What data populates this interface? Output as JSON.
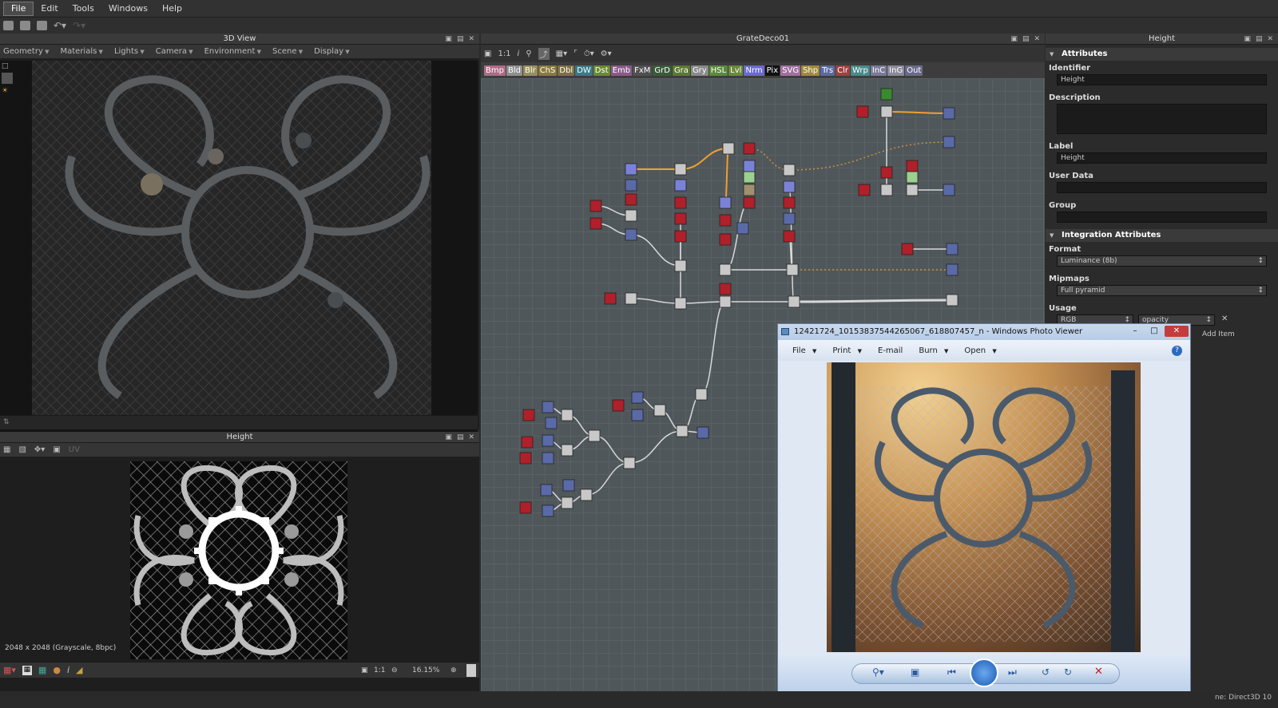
{
  "menubar": {
    "items": [
      "File",
      "Edit",
      "Tools",
      "Windows",
      "Help"
    ]
  },
  "view3d": {
    "title": "3D View",
    "menus": [
      "Geometry",
      "Materials",
      "Lights",
      "Camera",
      "Environment",
      "Scene",
      "Display"
    ]
  },
  "height": {
    "title": "Height",
    "info": "2048 x 2048 (Grayscale, 8bpc)",
    "zoom": "16.15%",
    "ratio": "1:1",
    "uv_label": "UV"
  },
  "graph": {
    "title": "GrateDeco01",
    "ratio": "1:1",
    "node_buttons": [
      {
        "label": "Bmp",
        "color": "#b06a86"
      },
      {
        "label": "Bld",
        "color": "#8f8f8f"
      },
      {
        "label": "Blr",
        "color": "#9a8f5a"
      },
      {
        "label": "ChS",
        "color": "#8a7a3a"
      },
      {
        "label": "Dbl",
        "color": "#807040"
      },
      {
        "label": "DW",
        "color": "#3a7a86"
      },
      {
        "label": "Dst",
        "color": "#6a8a30"
      },
      {
        "label": "Emb",
        "color": "#8a5a8a"
      },
      {
        "label": "FxM",
        "color": "#505050"
      },
      {
        "label": "GrD",
        "color": "#3a5a3a"
      },
      {
        "label": "Gra",
        "color": "#5a7a30"
      },
      {
        "label": "Gry",
        "color": "#8a8a8a"
      },
      {
        "label": "HSL",
        "color": "#5a8a3a"
      },
      {
        "label": "Lvl",
        "color": "#6a8a3a"
      },
      {
        "label": "Nrm",
        "color": "#6a6ad0"
      },
      {
        "label": "Pix",
        "color": "#111111"
      },
      {
        "label": "SVG",
        "color": "#a070a0"
      },
      {
        "label": "Shp",
        "color": "#a08a3a"
      },
      {
        "label": "Trs",
        "color": "#5a6aa0"
      },
      {
        "label": "Clr",
        "color": "#a04040"
      },
      {
        "label": "Wrp",
        "color": "#4a8a8a"
      },
      {
        "label": "InC",
        "color": "#7a7a9a"
      },
      {
        "label": "InG",
        "color": "#8a8a9a"
      },
      {
        "label": "Out",
        "color": "#6a6a8a"
      }
    ]
  },
  "attributes": {
    "title": "Height",
    "section1": "Attributes",
    "identifier_label": "Identifier",
    "identifier_value": "Height",
    "description_label": "Description",
    "label_label": "Label",
    "label_value": "Height",
    "userdata_label": "User Data",
    "group_label": "Group",
    "section2": "Integration Attributes",
    "format_label": "Format",
    "format_value": "Luminance (8b)",
    "mipmaps_label": "Mipmaps",
    "mipmaps_value": "Full pyramid",
    "usage_label": "Usage",
    "usage_value1": "RGB",
    "usage_value2": "opacity",
    "add_item": "Add Item"
  },
  "photoviewer": {
    "title": "12421724_10153837544265067_618807457_n - Windows Photo Viewer",
    "menus": [
      "File",
      "Print",
      "E-mail",
      "Burn",
      "Open"
    ]
  },
  "statusbar": {
    "engine": "ne: Direct3D 10"
  },
  "colors": {
    "accent": "#f0a030",
    "node_blue": "#7a82d8",
    "node_red": "#b0202a",
    "node_gray": "#c8c8c8"
  }
}
